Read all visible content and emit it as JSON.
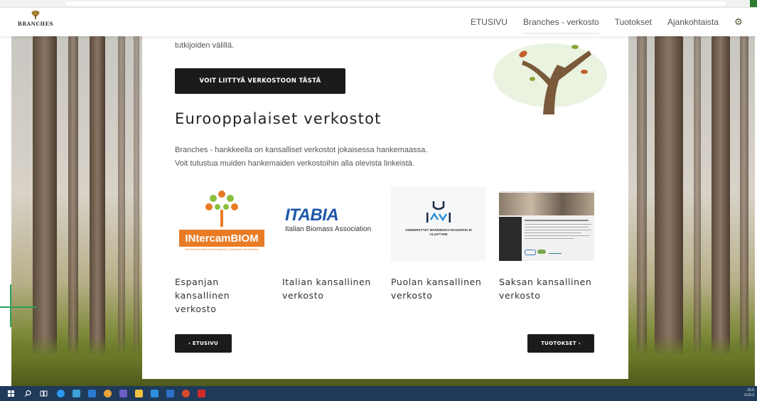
{
  "nav": {
    "logo_text": "BRANCHES",
    "items": [
      {
        "label": "ETUSIVU"
      },
      {
        "label": "Branches - verkosto"
      },
      {
        "label": "Tuotokset"
      },
      {
        "label": "Ajankohtaista"
      }
    ],
    "settings_icon": "gear-icon"
  },
  "content": {
    "intro_tail": "tutkijoiden välillä.",
    "join_button": "VOIT LIITTYÄ VERKOSTOON TÄSTÄ",
    "section_title": "Eurooppalaiset verkostot",
    "description": [
      "Branches - hankkeella on kansalliset verkostot jokaisessa hankemaassa.",
      "Voit tutustua muiden hankemaiden verkostoihin alla olevista linkeistä."
    ],
    "partners": [
      {
        "logo_text": "INtercamBIOM",
        "logo_sub": "Red de Intercambio de Innovaciones y Experiencias con Biomasa",
        "name": "Espanjan kansallinen verkosto"
      },
      {
        "logo_text": "ITABIA",
        "logo_sub": "Italian Biomass Association",
        "name": "Italian kansallinen verkosto"
      },
      {
        "logo_text": "UNIWERSYTET WARMIŃSKO-MAZURSKI W OLSZTYNIE",
        "name": "Puolan kansallinen verkosto"
      },
      {
        "name": "Saksan kansallinen verkosto"
      }
    ],
    "back_button": "‹ ETUSIVU",
    "next_button": "TUOTOKSET ›"
  },
  "taskbar": {
    "time": "15.5",
    "date": "3.10.2"
  },
  "colors": {
    "accent_green": "#2e9d5a",
    "button_dark": "#1b1b1b",
    "taskbar": "#1f3a5a",
    "intercam_orange": "#e97b25",
    "itabia_blue": "#1f57a8"
  }
}
